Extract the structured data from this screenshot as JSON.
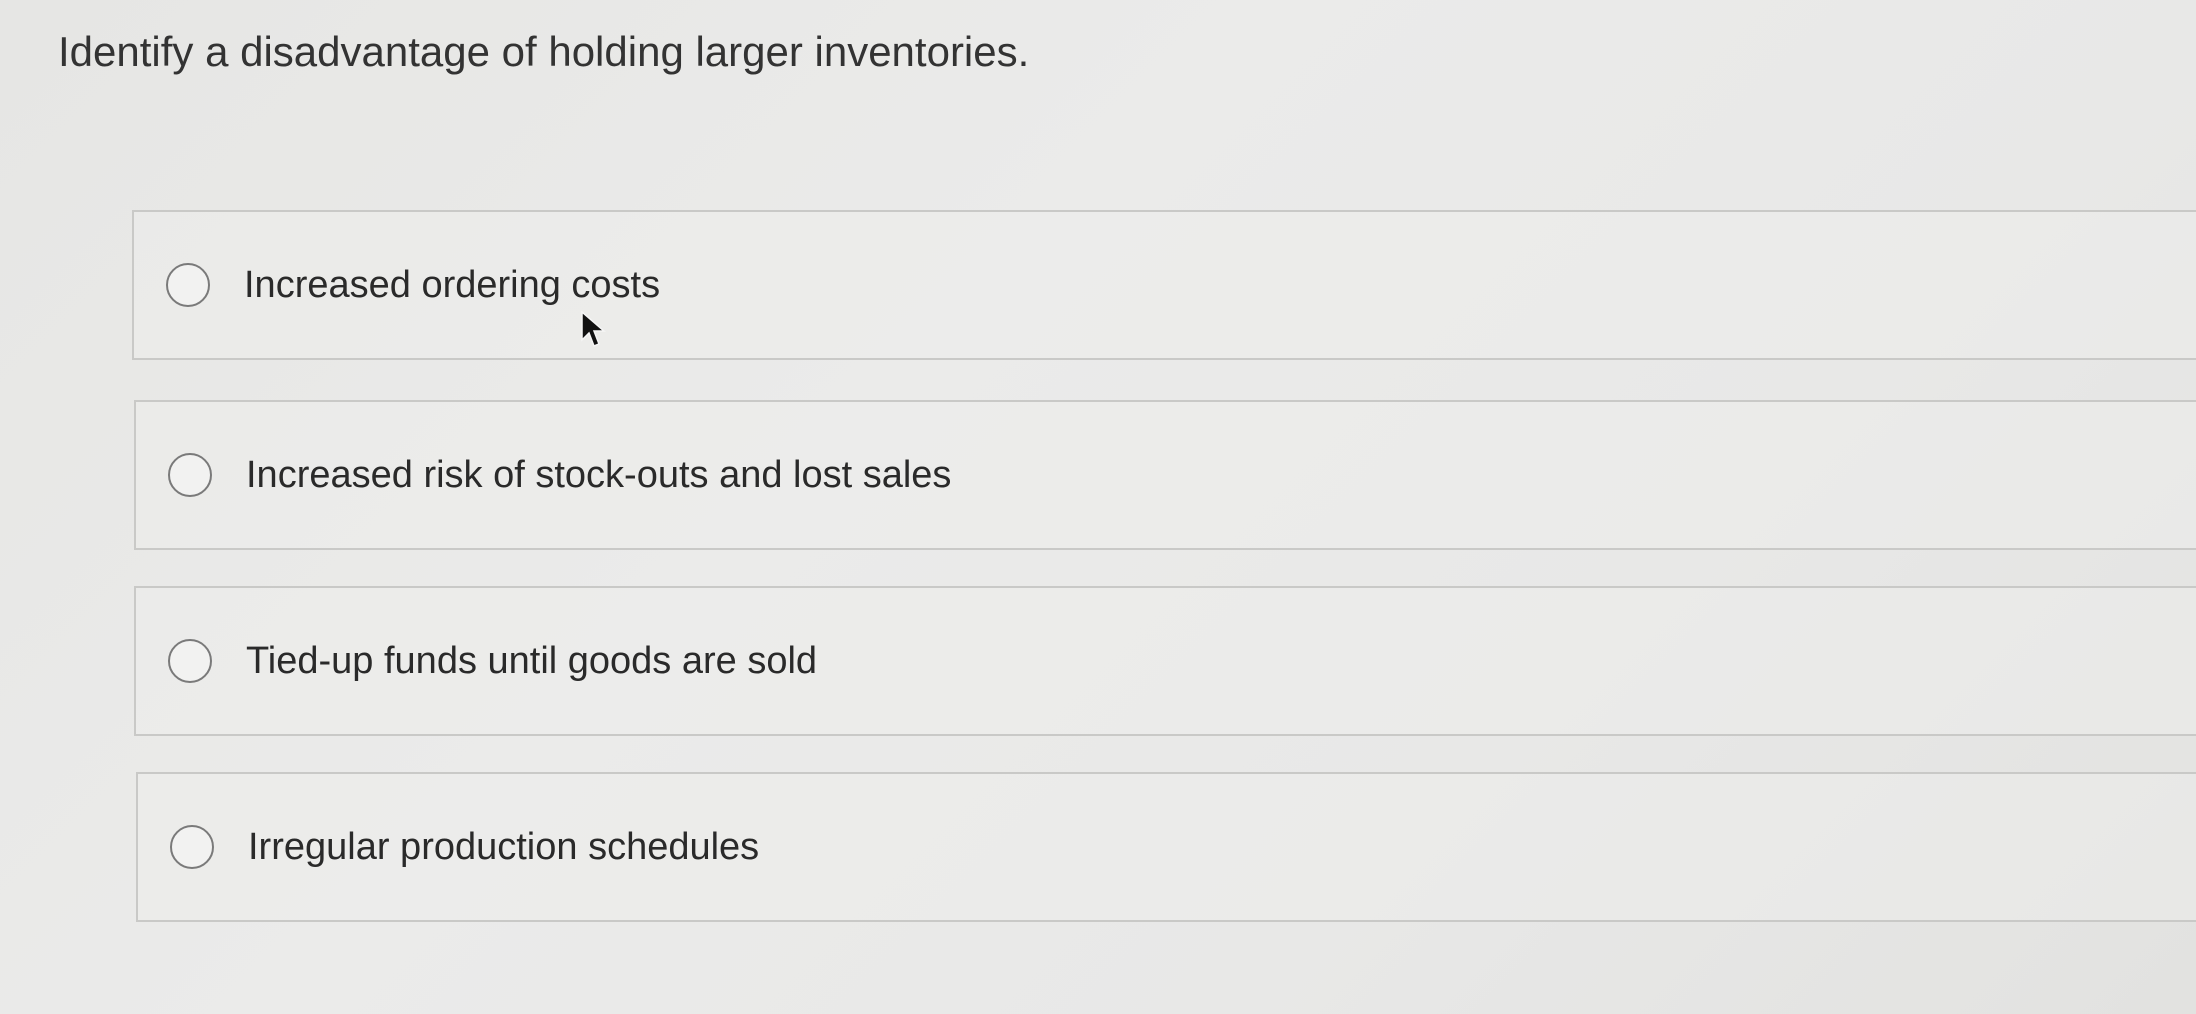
{
  "question": {
    "text": "Identify a disadvantage of holding larger inventories."
  },
  "options": [
    {
      "label": "Increased ordering costs",
      "selected": false
    },
    {
      "label": "Increased risk of stock-outs and lost sales",
      "selected": false
    },
    {
      "label": "Tied-up funds until goods are sold",
      "selected": false
    },
    {
      "label": "Irregular production schedules",
      "selected": false
    }
  ],
  "colors": {
    "background": "#e8e8e7",
    "option_border": "#c9c9c7",
    "radio_border": "#7a7a7a",
    "text": "#2a2a2a"
  },
  "icons": {
    "cursor": "mouse-pointer-icon"
  }
}
